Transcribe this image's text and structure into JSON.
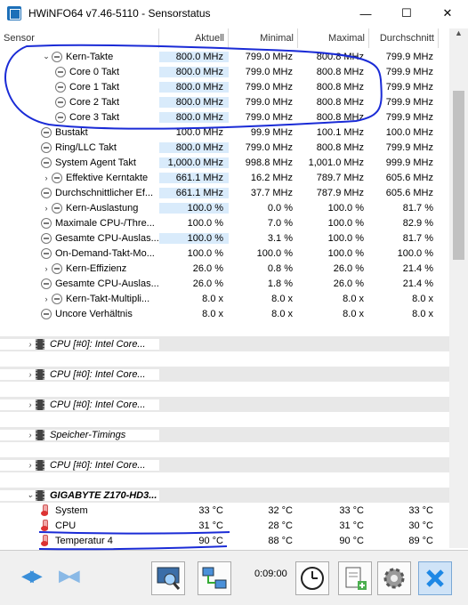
{
  "window": {
    "title": "HWiNFO64 v7.46-5110 - Sensorstatus",
    "btn_minimize": "—",
    "btn_maximize": "☐",
    "btn_close": "✕"
  },
  "columns": {
    "sensor": "Sensor",
    "current": "Aktuell",
    "min": "Minimal",
    "max": "Maximal",
    "avg": "Durchschnitt"
  },
  "rows": [
    {
      "name": "Kern-Takte",
      "cur": "800.0 MHz",
      "min": "799.0 MHz",
      "max": "800.8 MHz",
      "avg": "799.9 MHz"
    },
    {
      "name": "Core 0 Takt",
      "cur": "800.0 MHz",
      "min": "799.0 MHz",
      "max": "800.8 MHz",
      "avg": "799.9 MHz"
    },
    {
      "name": "Core 1 Takt",
      "cur": "800.0 MHz",
      "min": "799.0 MHz",
      "max": "800.8 MHz",
      "avg": "799.9 MHz"
    },
    {
      "name": "Core 2 Takt",
      "cur": "800.0 MHz",
      "min": "799.0 MHz",
      "max": "800.8 MHz",
      "avg": "799.9 MHz"
    },
    {
      "name": "Core 3 Takt",
      "cur": "800.0 MHz",
      "min": "799.0 MHz",
      "max": "800.8 MHz",
      "avg": "799.9 MHz"
    },
    {
      "name": "Bustakt",
      "cur": "100.0 MHz",
      "min": "99.9 MHz",
      "max": "100.1 MHz",
      "avg": "100.0 MHz"
    },
    {
      "name": "Ring/LLC Takt",
      "cur": "800.0 MHz",
      "min": "799.0 MHz",
      "max": "800.8 MHz",
      "avg": "799.9 MHz"
    },
    {
      "name": "System Agent Takt",
      "cur": "1,000.0 MHz",
      "min": "998.8 MHz",
      "max": "1,001.0 MHz",
      "avg": "999.9 MHz"
    },
    {
      "name": "Effektive Kerntakte",
      "cur": "661.1 MHz",
      "min": "16.2 MHz",
      "max": "789.7 MHz",
      "avg": "605.6 MHz"
    },
    {
      "name": "Durchschnittlicher Ef...",
      "cur": "661.1 MHz",
      "min": "37.7 MHz",
      "max": "787.9 MHz",
      "avg": "605.6 MHz"
    },
    {
      "name": "Kern-Auslastung",
      "cur": "100.0 %",
      "min": "0.0 %",
      "max": "100.0 %",
      "avg": "81.7 %"
    },
    {
      "name": "Maximale CPU-/Thre...",
      "cur": "100.0 %",
      "min": "7.0 %",
      "max": "100.0 %",
      "avg": "82.9 %"
    },
    {
      "name": "Gesamte CPU-Auslas...",
      "cur": "100.0 %",
      "min": "3.1 %",
      "max": "100.0 %",
      "avg": "81.7 %"
    },
    {
      "name": "On-Demand-Takt-Mo...",
      "cur": "100.0 %",
      "min": "100.0 %",
      "max": "100.0 %",
      "avg": "100.0 %"
    },
    {
      "name": "Kern-Effizienz",
      "cur": "26.0 %",
      "min": "0.8 %",
      "max": "26.0 %",
      "avg": "21.4 %"
    },
    {
      "name": "Gesamte CPU-Auslas...",
      "cur": "26.0 %",
      "min": "1.8 %",
      "max": "26.0 %",
      "avg": "21.4 %"
    },
    {
      "name": "Kern-Takt-Multipli...",
      "cur": "8.0 x",
      "min": "8.0 x",
      "max": "8.0 x",
      "avg": "8.0 x"
    },
    {
      "name": "Uncore Verhältnis",
      "cur": "8.0 x",
      "min": "8.0 x",
      "max": "8.0 x",
      "avg": "8.0 x"
    }
  ],
  "groups": [
    "CPU [#0]: Intel Core...",
    "CPU [#0]: Intel Core...",
    "CPU [#0]: Intel Core...",
    "Speicher-Timings",
    "CPU [#0]: Intel Core...",
    "GIGABYTE Z170-HD3..."
  ],
  "temps": [
    {
      "name": "System",
      "cur": "33 °C",
      "min": "32 °C",
      "max": "33 °C",
      "avg": "33 °C"
    },
    {
      "name": "CPU",
      "cur": "31 °C",
      "min": "28 °C",
      "max": "31 °C",
      "avg": "30 °C"
    },
    {
      "name": "Temperatur 4",
      "cur": "90 °C",
      "min": "88 °C",
      "max": "90 °C",
      "avg": "89 °C"
    }
  ],
  "toolbar": {
    "timer": "0:09:00",
    "nav_icon": "double-arrow-icon",
    "colors": {
      "accent": "#3a8fd9",
      "close": "#1e88e5",
      "highlight": "#d9ebfb",
      "markup": "#1a2bd6"
    }
  }
}
